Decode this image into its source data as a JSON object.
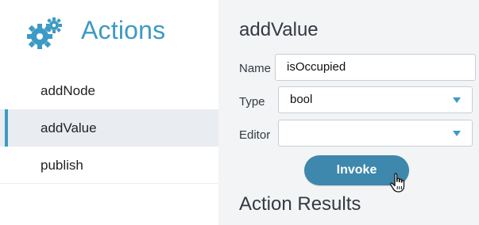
{
  "sidebar": {
    "title": "Actions",
    "icon": "gears-icon",
    "items": [
      {
        "label": "addNode",
        "active": false
      },
      {
        "label": "addValue",
        "active": true
      },
      {
        "label": "publish",
        "active": false
      }
    ]
  },
  "panel": {
    "title": "addValue",
    "fields": {
      "name": {
        "label": "Name",
        "value": "isOccupied"
      },
      "type": {
        "label": "Type",
        "value": "bool"
      },
      "editor": {
        "label": "Editor",
        "value": ""
      }
    },
    "invoke_label": "Invoke",
    "results_title": "Action Results"
  },
  "colors": {
    "accent": "#3d9ac4",
    "button": "#3e87ad",
    "panel_bg": "#f3f4f5",
    "active_bg": "#e9ecf0"
  }
}
